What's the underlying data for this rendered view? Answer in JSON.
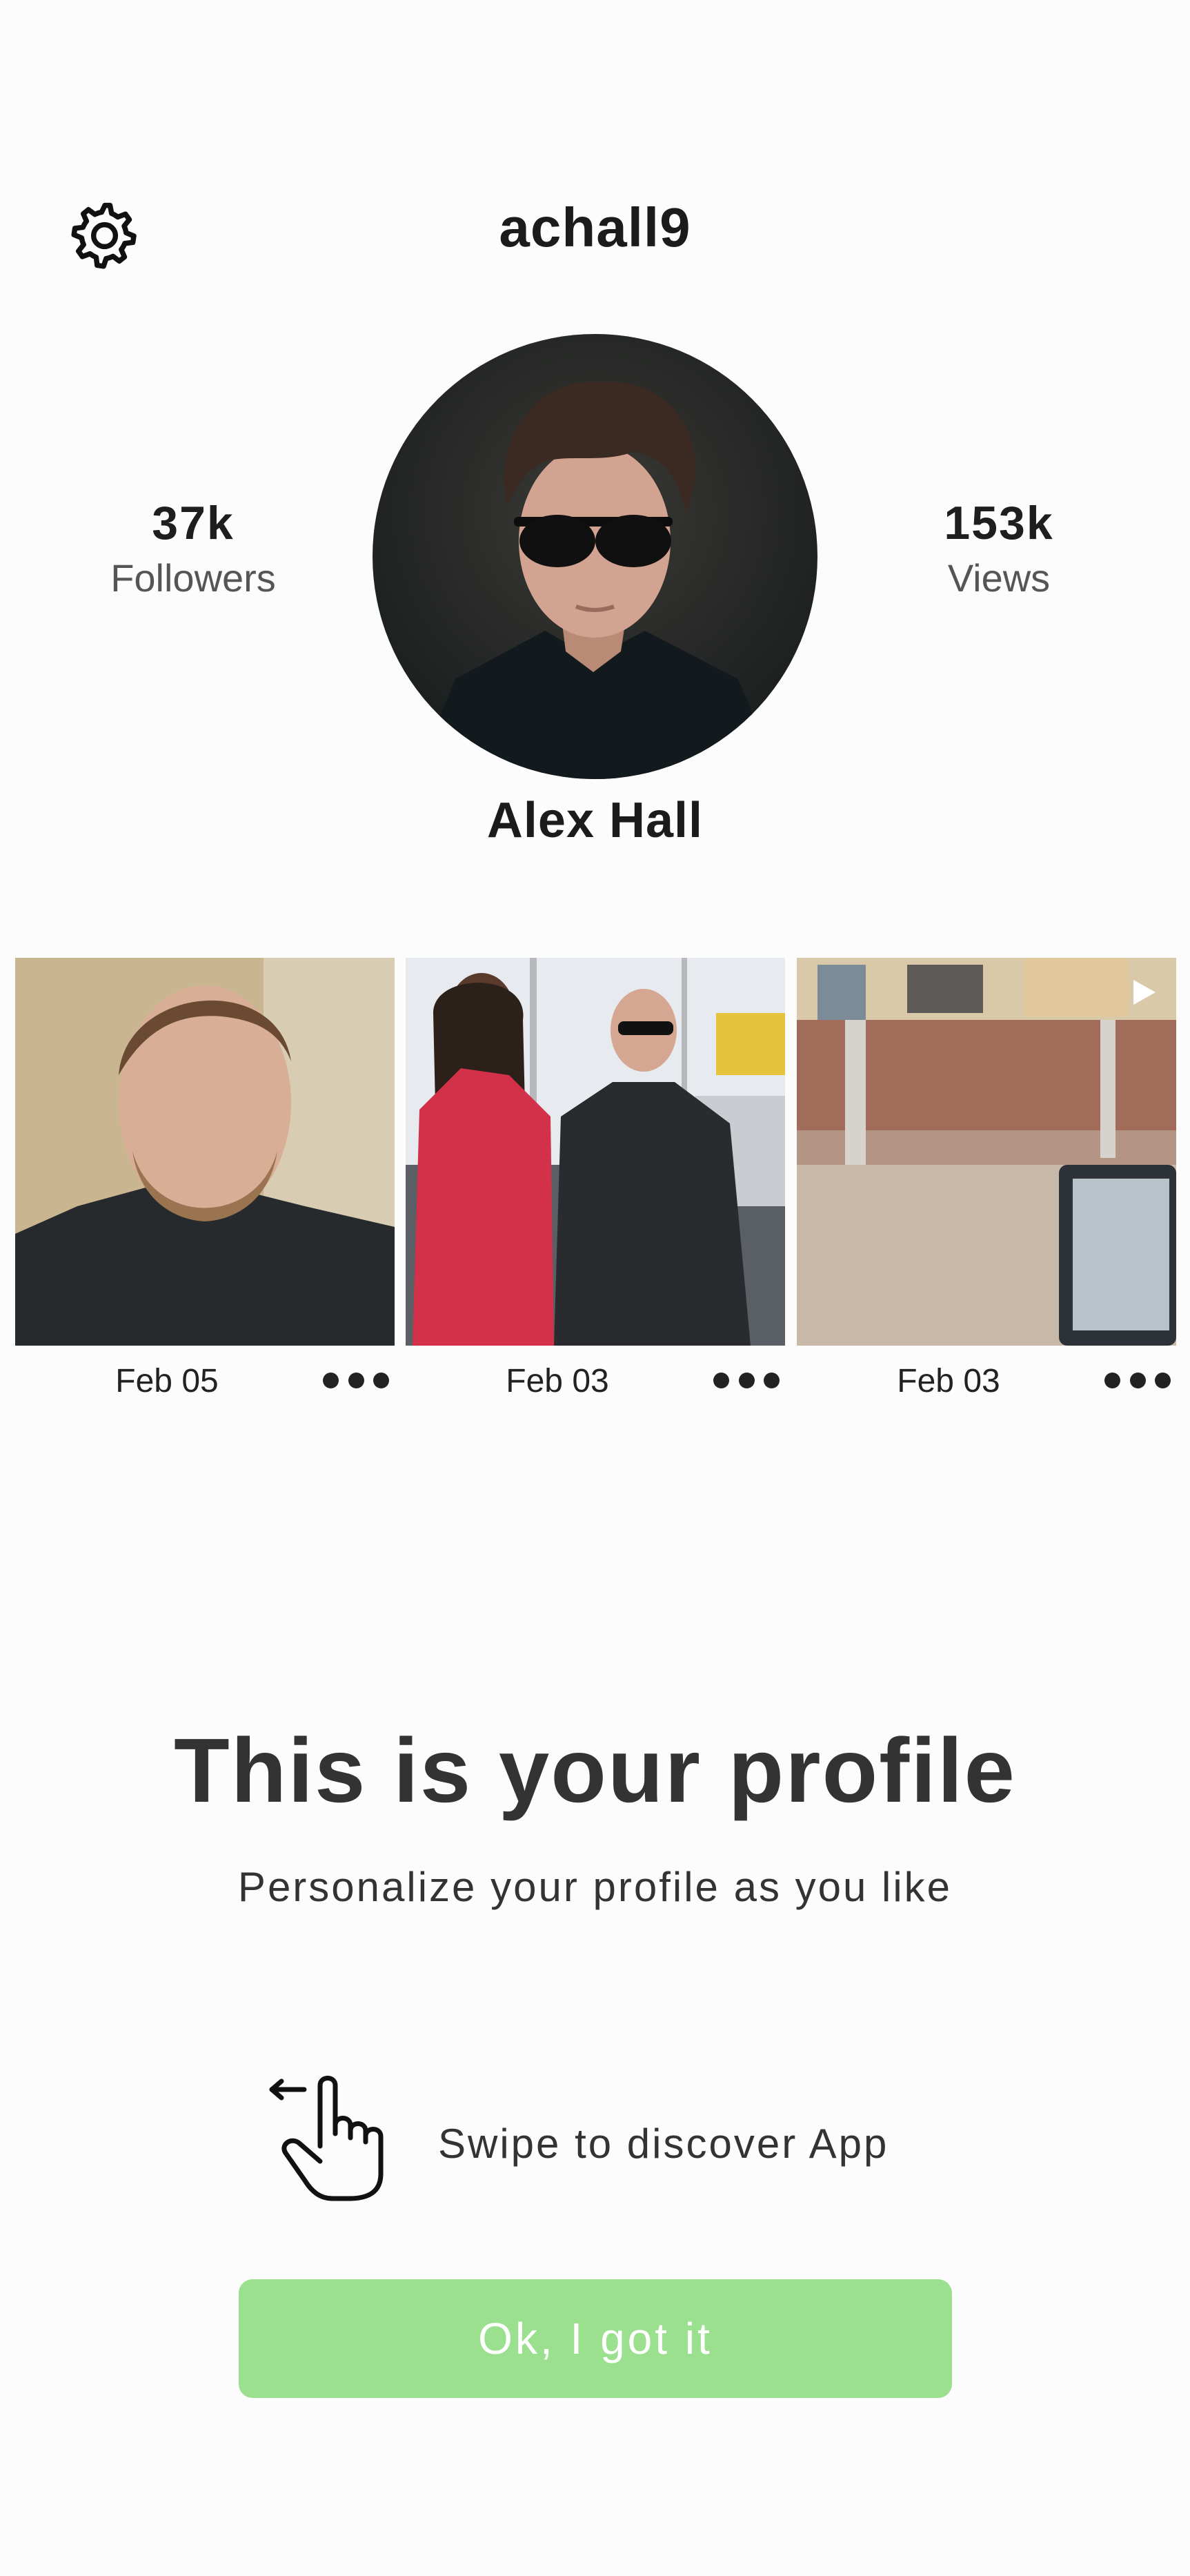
{
  "header": {
    "username": "achall9",
    "settings_icon": "gear-icon"
  },
  "profile": {
    "display_name": "Alex Hall",
    "avatar": "profile-photo"
  },
  "stats": {
    "followers_value": "37k",
    "followers_label": "Followers",
    "views_value": "153k",
    "views_label": "Views"
  },
  "posts": [
    {
      "date": "Feb 05",
      "more_icon": "more-dots-icon"
    },
    {
      "date": "Feb 03",
      "more_icon": "more-dots-icon"
    },
    {
      "date": "Feb 03",
      "more_icon": "more-dots-icon",
      "media": "video",
      "play_icon": "play-icon"
    }
  ],
  "onboarding": {
    "title": "This is your profile",
    "subtitle": "Personalize your profile as you like",
    "swipe_icon": "swipe-hand-icon",
    "swipe_text": "Swipe to discover App",
    "button_label": "Ok, I got it"
  },
  "colors": {
    "accent_button": "#9be08f",
    "background": "#fcfcfc",
    "text": "#2f2f2f"
  }
}
